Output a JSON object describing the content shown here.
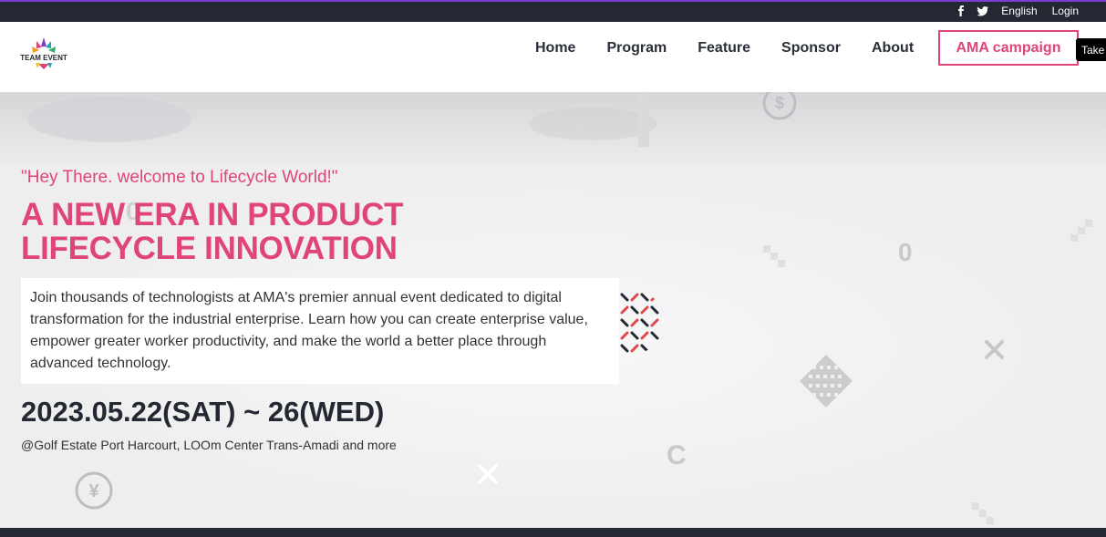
{
  "topbar": {
    "language": "English",
    "login": "Login",
    "social_icons": [
      "facebook-icon",
      "twitter-icon"
    ]
  },
  "header": {
    "logo_text": "TEAM EVENT",
    "nav": [
      "Home",
      "Program",
      "Feature",
      "Sponsor",
      "About"
    ],
    "cta": "AMA campaign",
    "tooltip": "Take"
  },
  "hero": {
    "greeting": "\"Hey There. welcome to Lifecycle World!\"",
    "headline_line1": "A NEW ERA IN PRODUCT",
    "headline_line2": "LIFECYCLE INNOVATION",
    "description": "Join thousands of technologists at AMA's premier annual event dedicated to digital transformation for the industrial enterprise. Learn how you can create enterprise value, empower greater worker productivity, and make the world a better place through advanced technology.",
    "date": "2023.05.22(SAT) ~ 26(WED)",
    "venue": "@Golf Estate Port Harcourt, LOOm Center Trans-Amadi and more"
  },
  "colors": {
    "accent": "#e0457a",
    "dark": "#232833"
  }
}
